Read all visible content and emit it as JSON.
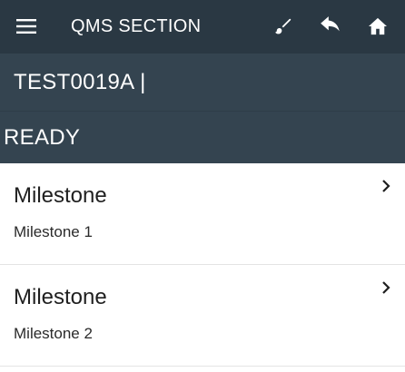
{
  "toolbar": {
    "title": "QMS SECTION",
    "menu_icon": "menu-icon",
    "actions": [
      {
        "icon": "brush-icon"
      },
      {
        "icon": "reply-icon"
      },
      {
        "icon": "home-icon"
      }
    ]
  },
  "record": {
    "label": "TEST0019A |"
  },
  "status": {
    "label": "READY"
  },
  "milestones": [
    {
      "title": "Milestone",
      "subtitle": "Milestone 1",
      "icon": "chevron-right-icon"
    },
    {
      "title": "Milestone",
      "subtitle": "Milestone 2",
      "icon": "chevron-right-icon"
    }
  ],
  "colors": {
    "toolbar_bg": "#2a3843",
    "header_bg": "#344450",
    "text_light": "#ffffff",
    "text_dark": "#1f1f1f"
  }
}
